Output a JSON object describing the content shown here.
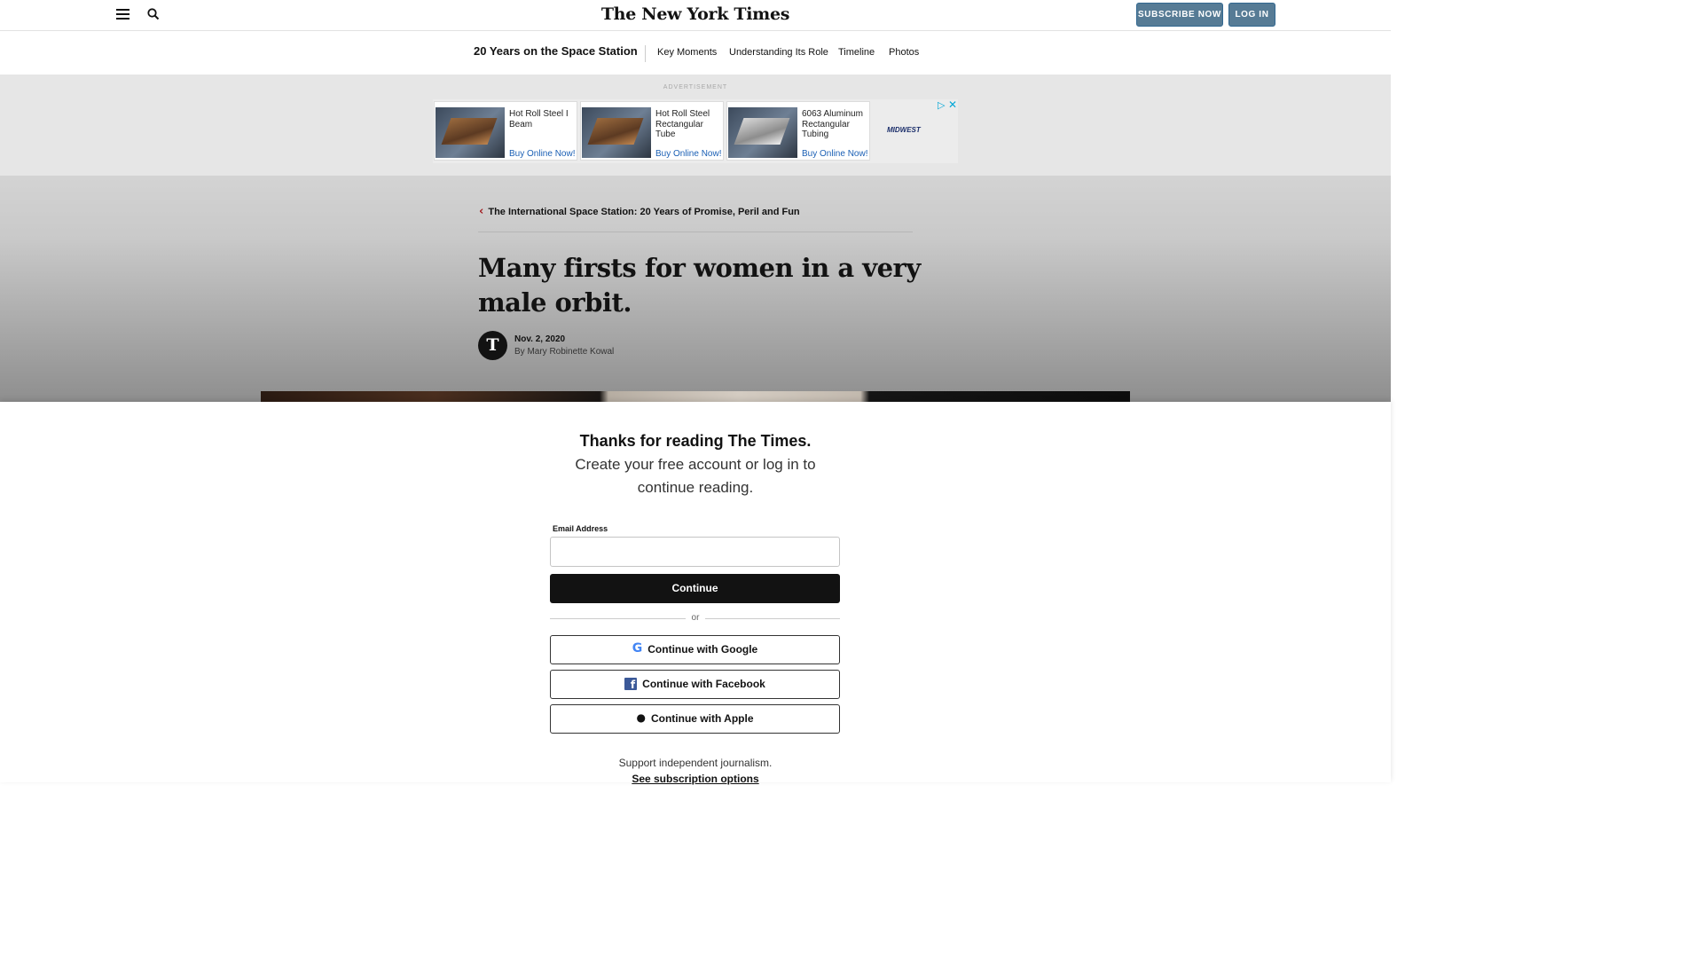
{
  "header": {
    "logo": "The New York Times",
    "subscribe_label": "SUBSCRIBE NOW",
    "login_label": "LOG IN"
  },
  "subnav": {
    "title": "20 Years on the Space Station",
    "items": [
      "Key Moments",
      "Understanding Its Role",
      "Timeline",
      "Photos"
    ]
  },
  "ad": {
    "label": "ADVERTISEMENT",
    "cards": [
      {
        "name": "Hot Roll Steel I Beam",
        "cta": "Buy Online Now!"
      },
      {
        "name": "Hot Roll Steel Rectangular Tube",
        "cta": "Buy Online Now!"
      },
      {
        "name": "6063 Aluminum Rectangular Tubing",
        "cta": "Buy Online Now!"
      }
    ],
    "brand": "MIDWEST",
    "play_icon": "▷",
    "close_icon": "✕"
  },
  "article": {
    "breadcrumb": "The International Space Station: 20 Years of Promise, Peril and Fun",
    "headline": "Many firsts for women in a very male orbit.",
    "date": "Nov. 2, 2020",
    "byline": "By Mary Robinette Kowal",
    "avatar_letter": "T"
  },
  "login": {
    "title": "Thanks for reading The Times.",
    "subtitle": "Create your free account or log in to continue reading.",
    "email_label": "Email Address",
    "email_value": "",
    "continue_label": "Continue",
    "or_label": "or",
    "google_label": "Continue with Google",
    "facebook_label": "Continue with Facebook",
    "apple_label": "Continue with Apple",
    "support_text": "Support independent journalism.",
    "options_label": "See subscription options"
  }
}
